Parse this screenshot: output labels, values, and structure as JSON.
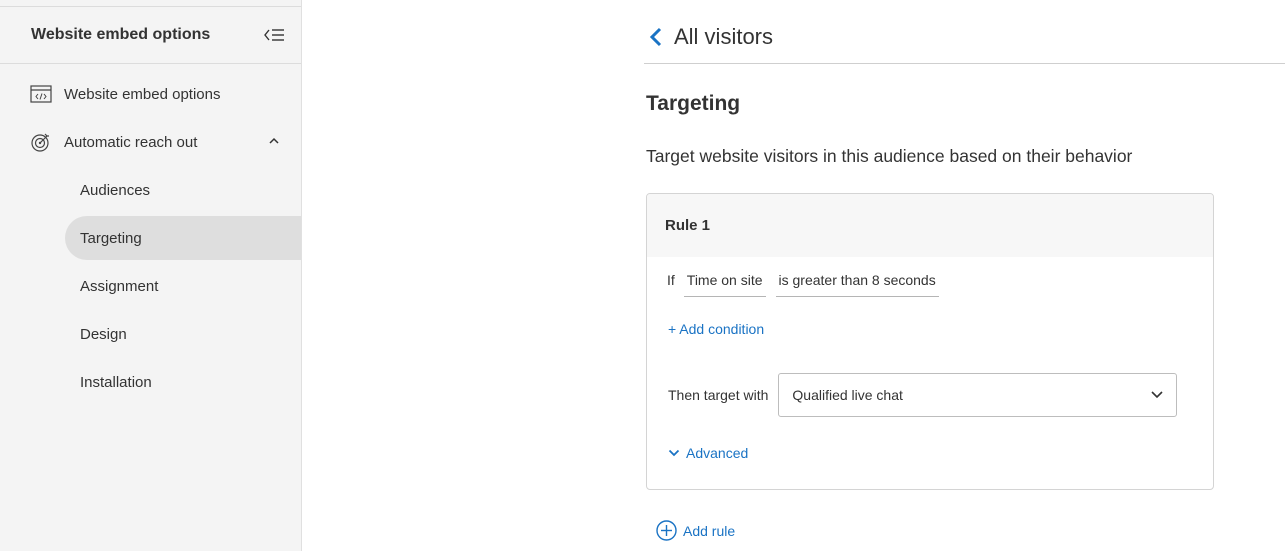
{
  "sidebar": {
    "title": "Website embed options",
    "items": [
      {
        "label": "Website embed options",
        "icon": "code-window-icon"
      },
      {
        "label": "Automatic reach out",
        "icon": "target-icon",
        "expanded": true
      }
    ],
    "sub_items": [
      {
        "label": "Audiences"
      },
      {
        "label": "Targeting",
        "active": true
      },
      {
        "label": "Assignment"
      },
      {
        "label": "Design"
      },
      {
        "label": "Installation"
      }
    ]
  },
  "main": {
    "back_label": "All visitors",
    "section_title": "Targeting",
    "section_desc": "Target website visitors in this audience based on their behavior",
    "rule": {
      "title": "Rule 1",
      "if_label": "If",
      "field": "Time on site",
      "condition": "is greater than 8 seconds",
      "add_condition": "+ Add condition",
      "then_label": "Then target with",
      "target_value": "Qualified live chat",
      "advanced_label": "Advanced"
    },
    "add_rule_label": "Add rule"
  },
  "colors": {
    "accent": "#1a73c4",
    "sidebar_bg": "#f4f4f4",
    "active_bg": "#dedede"
  }
}
